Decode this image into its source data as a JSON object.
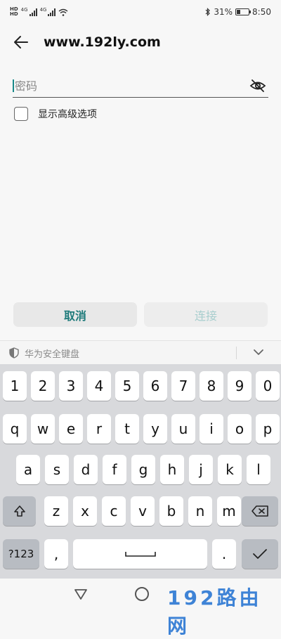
{
  "status_bar": {
    "hd1": "HD",
    "hd2": "HD",
    "net1": "4G",
    "net2": "4G",
    "battery_percent_text": "31%",
    "battery_level": 0.31,
    "time": "8:50"
  },
  "header": {
    "title": "www.192ly.com"
  },
  "form": {
    "password_placeholder": "密码",
    "password_value": "",
    "show_advanced_label": "显示高级选项",
    "show_advanced_checked": false
  },
  "actions": {
    "cancel_label": "取消",
    "connect_label": "连接"
  },
  "keyboard_header": {
    "title": "华为安全键盘"
  },
  "keyboard": {
    "row1": [
      "1",
      "2",
      "3",
      "4",
      "5",
      "6",
      "7",
      "8",
      "9",
      "0"
    ],
    "row2": [
      "q",
      "w",
      "e",
      "r",
      "t",
      "y",
      "u",
      "i",
      "o",
      "p"
    ],
    "row3": [
      "a",
      "s",
      "d",
      "f",
      "g",
      "h",
      "j",
      "k",
      "l"
    ],
    "row4": [
      "z",
      "x",
      "c",
      "v",
      "b",
      "n",
      "m"
    ],
    "symbols_label": "?123",
    "comma": ",",
    "period": "."
  },
  "watermark": "192路由网"
}
